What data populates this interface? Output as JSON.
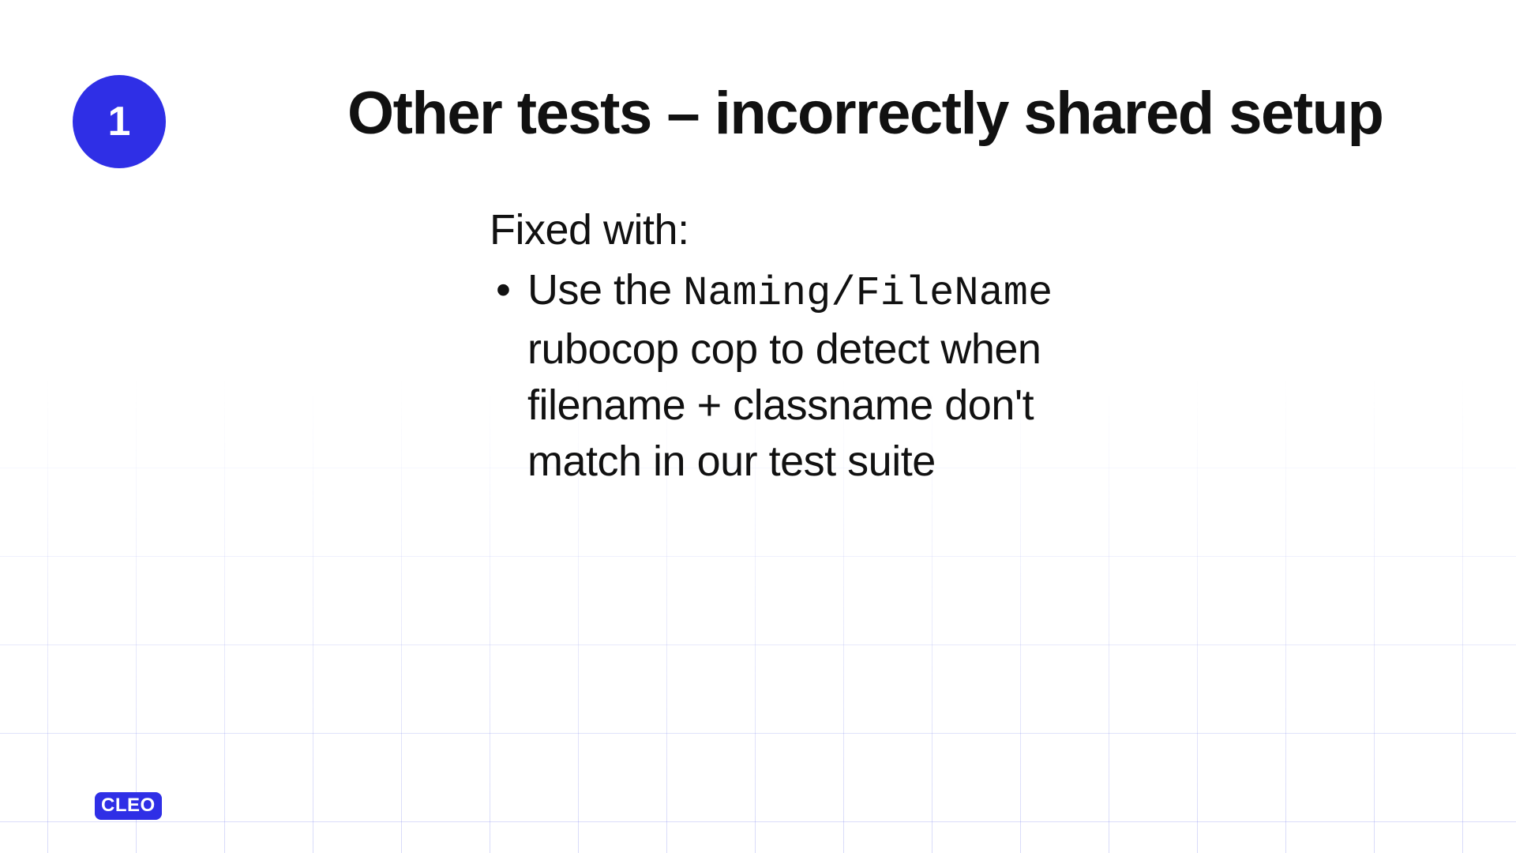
{
  "badge": {
    "number": "1"
  },
  "title": "Other tests – incorrectly shared setup",
  "content": {
    "lead": "Fixed with:",
    "bullet": {
      "prefix": "Use the ",
      "code": "Naming/FileName",
      "rest": " rubocop cop to detect when filename + classname don't match in our test suite"
    }
  },
  "logo": {
    "text": "CLEO"
  },
  "colors": {
    "accent": "#2f2fe6"
  }
}
